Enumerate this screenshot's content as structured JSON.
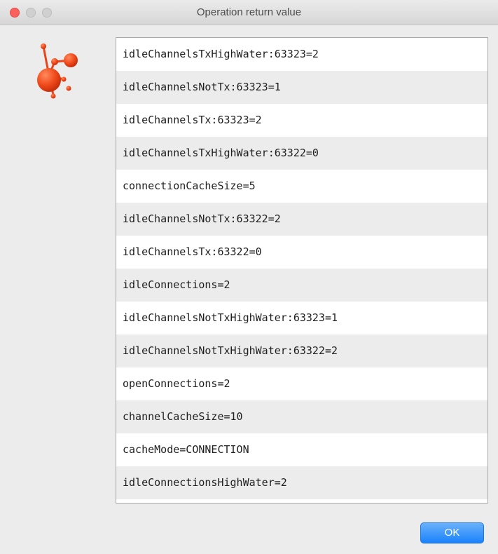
{
  "window": {
    "title": "Operation return value"
  },
  "icons": {
    "app_logo": "molecule-logo-icon",
    "accent": "#f04a1c"
  },
  "return_values": [
    "idleChannelsTxHighWater:63323=2",
    "idleChannelsNotTx:63323=1",
    "idleChannelsTx:63323=2",
    "idleChannelsTxHighWater:63322=0",
    "connectionCacheSize=5",
    "idleChannelsNotTx:63322=2",
    "idleChannelsTx:63322=0",
    "idleConnections=2",
    "idleChannelsNotTxHighWater:63323=1",
    "idleChannelsNotTxHighWater:63322=2",
    "openConnections=2",
    "channelCacheSize=10",
    "cacheMode=CONNECTION",
    "idleConnectionsHighWater=2"
  ],
  "buttons": {
    "ok_label": "OK"
  }
}
